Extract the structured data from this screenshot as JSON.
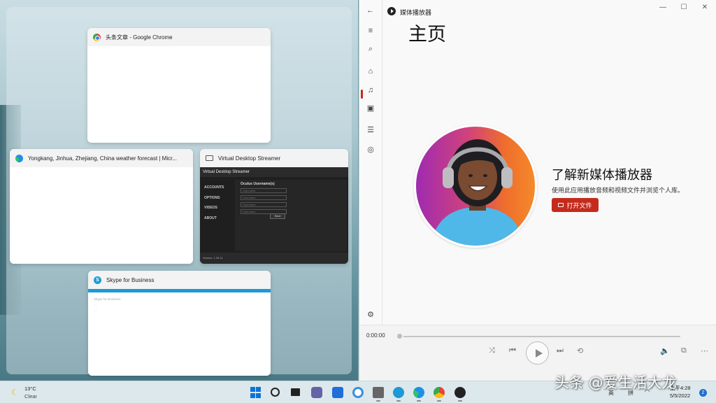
{
  "snap_assist": {
    "windows": [
      {
        "title": "头条文章 - Google Chrome",
        "icon": "chrome-icon"
      },
      {
        "title": "Yongkang, Jinhua, Zhejiang, China weather forecast | Micr...",
        "icon": "edge-icon"
      },
      {
        "title": "Virtual Desktop Streamer",
        "icon": "monitor-icon"
      },
      {
        "title": "Skype for Business",
        "icon": "skype-icon"
      }
    ],
    "vds": {
      "title": "Virtual Desktop Streamer",
      "nav": [
        "ACCOUNTS",
        "OPTIONS",
        "VIDEOS",
        "ABOUT"
      ],
      "fields_label": "Oculus Username(s)",
      "field_placeholder": "Username",
      "save_label": "Save",
      "version": "Version: 1.25.11"
    },
    "skype": {
      "heading": "Skype for Business",
      "lines": [
        "Skype for Business",
        "...",
        "..."
      ]
    }
  },
  "media_player": {
    "app_title": "媒体播放器",
    "page_title": "主页",
    "hero_heading": "了解新媒体播放器",
    "hero_sub": "使用此应用播放音频和视频文件并浏览个人库。",
    "open_button": "打开文件",
    "time": "0:00:00",
    "progress": 0,
    "accent": "#c42b1c",
    "rail_icons": [
      "menu-icon",
      "search-icon",
      "home-icon",
      "music-icon",
      "video-icon",
      "playlist-icon",
      "now-playing-icon",
      "settings-icon"
    ]
  },
  "taskbar": {
    "weather_temp": "13°C",
    "weather_desc": "Clear",
    "ime_lang": "英",
    "ime_mode": "拼",
    "time": "上午4:28",
    "date": "5/5/2022",
    "notification_count": "2"
  },
  "watermark": "头条 @爱生活大龙"
}
